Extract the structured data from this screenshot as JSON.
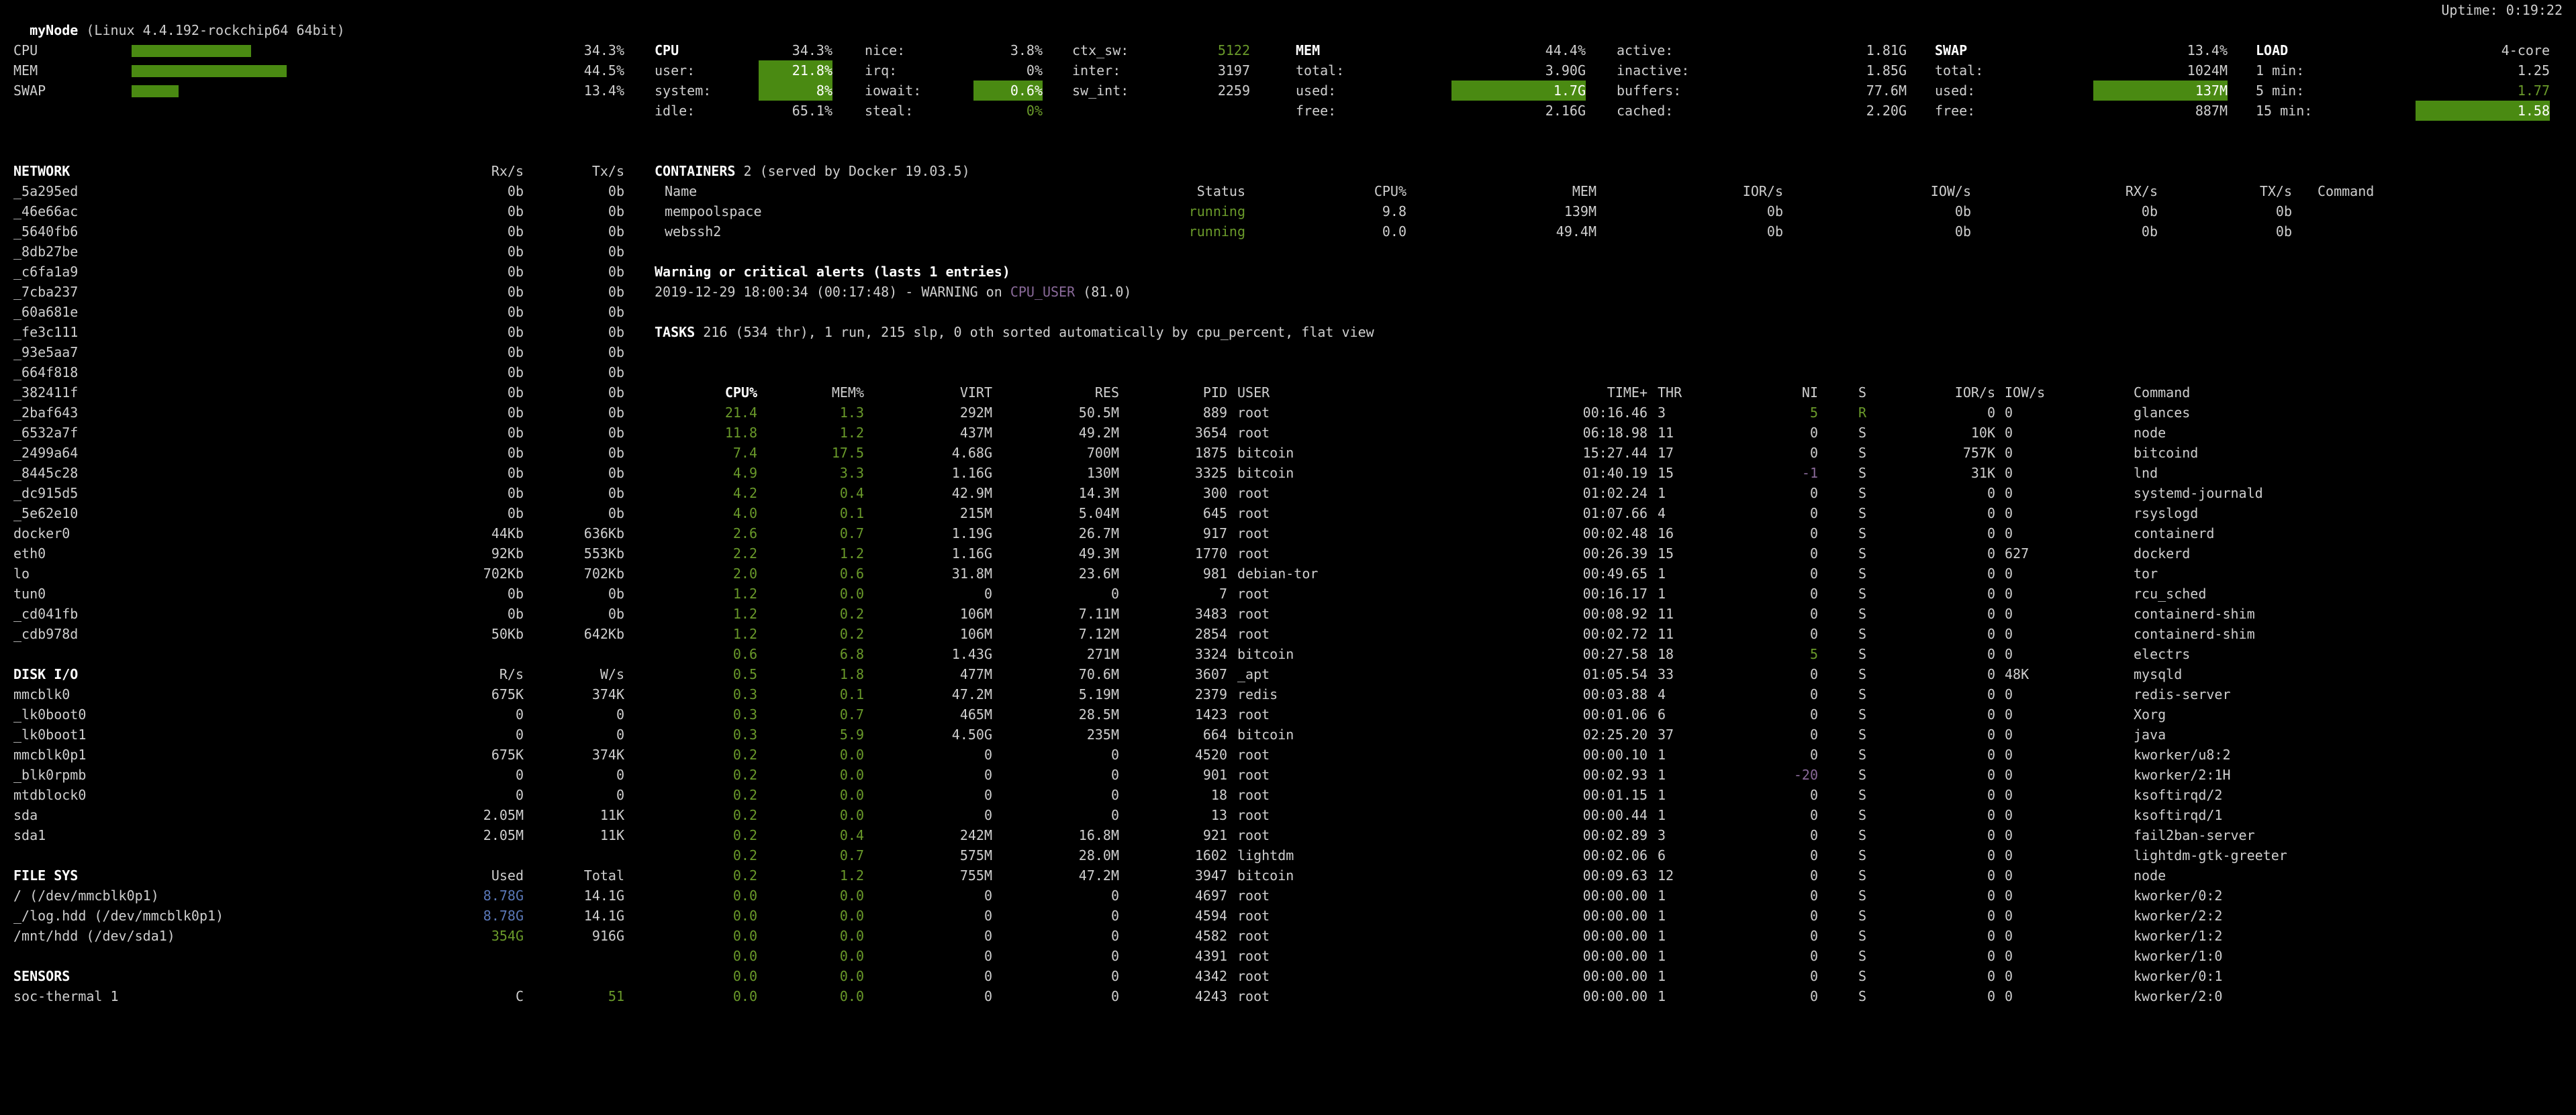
{
  "header": {
    "host": "myNode",
    "os": "(Linux 4.4.192-rockchip64 64bit)",
    "uptime": "Uptime: 0:19:22"
  },
  "quicklook": [
    {
      "label": "CPU",
      "value": "34.3%",
      "fraction": 0.343
    },
    {
      "label": "MEM",
      "value": "44.5%",
      "fraction": 0.445
    },
    {
      "label": "SWAP",
      "value": "13.4%",
      "fraction": 0.134
    }
  ],
  "cpu": {
    "title": "CPU",
    "total": "34.3%",
    "col1": [
      {
        "k": "user:",
        "v": "21.8%",
        "hl": true
      },
      {
        "k": "system:",
        "v": "8%",
        "hl": true
      },
      {
        "k": "idle:",
        "v": "65.1%",
        "hl": false
      }
    ],
    "col2": [
      {
        "k": "nice:",
        "v": "3.8%"
      },
      {
        "k": "irq:",
        "v": "0%"
      },
      {
        "k": "iowait:",
        "v": "0.6%",
        "hl": true
      },
      {
        "k": "steal:",
        "v": "0%",
        "green": true
      }
    ],
    "col3": [
      {
        "k": "ctx_sw:",
        "v": "5122",
        "green": true
      },
      {
        "k": "inter:",
        "v": "3197"
      },
      {
        "k": "sw_int:",
        "v": "2259"
      }
    ]
  },
  "mem": {
    "title": "MEM",
    "total": "44.4%",
    "col1": [
      {
        "k": "total:",
        "v": "3.90G"
      },
      {
        "k": "used:",
        "v": "1.7G",
        "hl": true
      },
      {
        "k": "free:",
        "v": "2.16G"
      }
    ],
    "col2": [
      {
        "k": "active:",
        "v": "1.81G"
      },
      {
        "k": "inactive:",
        "v": "1.85G"
      },
      {
        "k": "buffers:",
        "v": "77.6M"
      },
      {
        "k": "cached:",
        "v": "2.20G"
      }
    ]
  },
  "swap": {
    "title": "SWAP",
    "total": "13.4%",
    "rows": [
      {
        "k": "total:",
        "v": "1024M"
      },
      {
        "k": "used:",
        "v": "137M",
        "hl": true
      },
      {
        "k": "free:",
        "v": "887M"
      }
    ]
  },
  "load": {
    "title": "LOAD",
    "cores": "4-core",
    "rows": [
      {
        "k": "1 min:",
        "v": "1.25"
      },
      {
        "k": "5 min:",
        "v": "1.77",
        "green": true
      },
      {
        "k": "15 min:",
        "v": "1.58",
        "hl": true
      }
    ]
  },
  "network": {
    "title": "NETWORK",
    "rx": "Rx/s",
    "tx": "Tx/s",
    "rows": [
      [
        "_5a295ed",
        "0b",
        "0b"
      ],
      [
        "_46e66ac",
        "0b",
        "0b"
      ],
      [
        "_5640fb6",
        "0b",
        "0b"
      ],
      [
        "_8db27be",
        "0b",
        "0b"
      ],
      [
        "_c6fa1a9",
        "0b",
        "0b"
      ],
      [
        "_7cba237",
        "0b",
        "0b"
      ],
      [
        "_60a681e",
        "0b",
        "0b"
      ],
      [
        "_fe3c111",
        "0b",
        "0b"
      ],
      [
        "_93e5aa7",
        "0b",
        "0b"
      ],
      [
        "_664f818",
        "0b",
        "0b"
      ],
      [
        "_382411f",
        "0b",
        "0b"
      ],
      [
        "_2baf643",
        "0b",
        "0b"
      ],
      [
        "_6532a7f",
        "0b",
        "0b"
      ],
      [
        "_2499a64",
        "0b",
        "0b"
      ],
      [
        "_8445c28",
        "0b",
        "0b"
      ],
      [
        "_dc915d5",
        "0b",
        "0b"
      ],
      [
        "_5e62e10",
        "0b",
        "0b"
      ],
      [
        "docker0",
        "44Kb",
        "636Kb"
      ],
      [
        "eth0",
        "92Kb",
        "553Kb"
      ],
      [
        "lo",
        "702Kb",
        "702Kb"
      ],
      [
        "tun0",
        "0b",
        "0b"
      ],
      [
        "_cd041fb",
        "0b",
        "0b"
      ],
      [
        "_cdb978d",
        "50Kb",
        "642Kb"
      ]
    ]
  },
  "diskio": {
    "title": "DISK I/O",
    "r": "R/s",
    "w": "W/s",
    "rows": [
      [
        "mmcblk0",
        "675K",
        "374K"
      ],
      [
        "_lk0boot0",
        "0",
        "0"
      ],
      [
        "_lk0boot1",
        "0",
        "0"
      ],
      [
        "mmcblk0p1",
        "675K",
        "374K"
      ],
      [
        "_blk0rpmb",
        "0",
        "0"
      ],
      [
        "mtdblock0",
        "0",
        "0"
      ],
      [
        "sda",
        "2.05M",
        "11K"
      ],
      [
        "sda1",
        "2.05M",
        "11K"
      ]
    ]
  },
  "fs": {
    "title": "FILE SYS",
    "used": "Used",
    "total": "Total",
    "rows": [
      {
        "name": "/ (/dev/mmcblk0p1)",
        "used": "8.78G",
        "total": "14.1G",
        "c": "blue"
      },
      {
        "name": "_/log.hdd (/dev/mmcblk0p1)",
        "used": "8.78G",
        "total": "14.1G",
        "c": "blue"
      },
      {
        "name": "/mnt/hdd (/dev/sda1)",
        "used": "354G",
        "total": "916G",
        "c": "green"
      }
    ]
  },
  "sensors": {
    "title": "SENSORS",
    "rows": [
      {
        "name": "soc-thermal 1",
        "unit": "C",
        "value": "51"
      }
    ]
  },
  "containers": {
    "title": "CONTAINERS",
    "count": "2",
    "served": "(served by Docker 19.03.5)",
    "headers": [
      "Name",
      "Status",
      "CPU%",
      "MEM",
      "IOR/s",
      "IOW/s",
      "RX/s",
      "TX/s",
      "Command"
    ],
    "rows": [
      [
        "mempoolspace",
        "running",
        "9.8",
        "139M",
        "0b",
        "0b",
        "0b",
        "0b",
        ""
      ],
      [
        "webssh2",
        "running",
        "0.0",
        "49.4M",
        "0b",
        "0b",
        "0b",
        "0b",
        ""
      ]
    ]
  },
  "alerts": {
    "title": "Warning or critical alerts (lasts 1 entries)",
    "entry_prefix": "2019-12-29 18:00:34 (00:17:48) - WARNING on ",
    "entry_key": "CPU_USER",
    "entry_suffix": " (81.0)"
  },
  "tasks": {
    "title": "TASKS",
    "summary": "216 (534 thr), 1 run, 215 slp, 0 oth sorted automatically by cpu_percent, flat view"
  },
  "processes": {
    "headers": {
      "cpu": "CPU%",
      "mem": "MEM%",
      "virt": "VIRT",
      "res": "RES",
      "pid": "PID",
      "user": "USER",
      "time": "TIME+",
      "thr": "THR",
      "ni": "NI",
      "s": "S",
      "ior": "IOR/s",
      "iow": "IOW/s",
      "cmd": "Command"
    },
    "rows": [
      [
        "21.4",
        "1.3",
        "292M",
        "50.5M",
        "889",
        "root",
        "00:16.46",
        "3",
        "5",
        "R",
        "0",
        "0",
        "glances"
      ],
      [
        "11.8",
        "1.2",
        "437M",
        "49.2M",
        "3654",
        "root",
        "06:18.98",
        "11",
        "0",
        "S",
        "10K",
        "0",
        "node"
      ],
      [
        "7.4",
        "17.5",
        "4.68G",
        "700M",
        "1875",
        "bitcoin",
        "15:27.44",
        "17",
        "0",
        "S",
        "757K",
        "0",
        "bitcoind"
      ],
      [
        "4.9",
        "3.3",
        "1.16G",
        "130M",
        "3325",
        "bitcoin",
        "01:40.19",
        "15",
        "-1",
        "S",
        "31K",
        "0",
        "lnd"
      ],
      [
        "4.2",
        "0.4",
        "42.9M",
        "14.3M",
        "300",
        "root",
        "01:02.24",
        "1",
        "0",
        "S",
        "0",
        "0",
        "systemd-journald"
      ],
      [
        "4.0",
        "0.1",
        "215M",
        "5.04M",
        "645",
        "root",
        "01:07.66",
        "4",
        "0",
        "S",
        "0",
        "0",
        "rsyslogd"
      ],
      [
        "2.6",
        "0.7",
        "1.19G",
        "26.7M",
        "917",
        "root",
        "00:02.48",
        "16",
        "0",
        "S",
        "0",
        "0",
        "containerd"
      ],
      [
        "2.2",
        "1.2",
        "1.16G",
        "49.3M",
        "1770",
        "root",
        "00:26.39",
        "15",
        "0",
        "S",
        "0",
        "627",
        "dockerd"
      ],
      [
        "2.0",
        "0.6",
        "31.8M",
        "23.6M",
        "981",
        "debian-tor",
        "00:49.65",
        "1",
        "0",
        "S",
        "0",
        "0",
        "tor"
      ],
      [
        "1.2",
        "0.0",
        "0",
        "0",
        "7",
        "root",
        "00:16.17",
        "1",
        "0",
        "S",
        "0",
        "0",
        "rcu_sched"
      ],
      [
        "1.2",
        "0.2",
        "106M",
        "7.11M",
        "3483",
        "root",
        "00:08.92",
        "11",
        "0",
        "S",
        "0",
        "0",
        "containerd-shim"
      ],
      [
        "1.2",
        "0.2",
        "106M",
        "7.12M",
        "2854",
        "root",
        "00:02.72",
        "11",
        "0",
        "S",
        "0",
        "0",
        "containerd-shim"
      ],
      [
        "0.6",
        "6.8",
        "1.43G",
        "271M",
        "3324",
        "bitcoin",
        "00:27.58",
        "18",
        "5",
        "S",
        "0",
        "0",
        "electrs"
      ],
      [
        "0.5",
        "1.8",
        "477M",
        "70.6M",
        "3607",
        "_apt",
        "01:05.54",
        "33",
        "0",
        "S",
        "0",
        "48K",
        "mysqld"
      ],
      [
        "0.3",
        "0.1",
        "47.2M",
        "5.19M",
        "2379",
        "redis",
        "00:03.88",
        "4",
        "0",
        "S",
        "0",
        "0",
        "redis-server"
      ],
      [
        "0.3",
        "0.7",
        "465M",
        "28.5M",
        "1423",
        "root",
        "00:01.06",
        "6",
        "0",
        "S",
        "0",
        "0",
        "Xorg"
      ],
      [
        "0.3",
        "5.9",
        "4.50G",
        "235M",
        "664",
        "bitcoin",
        "02:25.20",
        "37",
        "0",
        "S",
        "0",
        "0",
        "java"
      ],
      [
        "0.2",
        "0.0",
        "0",
        "0",
        "4520",
        "root",
        "00:00.10",
        "1",
        "0",
        "S",
        "0",
        "0",
        "kworker/u8:2"
      ],
      [
        "0.2",
        "0.0",
        "0",
        "0",
        "901",
        "root",
        "00:02.93",
        "1",
        "-20",
        "S",
        "0",
        "0",
        "kworker/2:1H"
      ],
      [
        "0.2",
        "0.0",
        "0",
        "0",
        "18",
        "root",
        "00:01.15",
        "1",
        "0",
        "S",
        "0",
        "0",
        "ksoftirqd/2"
      ],
      [
        "0.2",
        "0.0",
        "0",
        "0",
        "13",
        "root",
        "00:00.44",
        "1",
        "0",
        "S",
        "0",
        "0",
        "ksoftirqd/1"
      ],
      [
        "0.2",
        "0.4",
        "242M",
        "16.8M",
        "921",
        "root",
        "00:02.89",
        "3",
        "0",
        "S",
        "0",
        "0",
        "fail2ban-server"
      ],
      [
        "0.2",
        "0.7",
        "575M",
        "28.0M",
        "1602",
        "lightdm",
        "00:02.06",
        "6",
        "0",
        "S",
        "0",
        "0",
        "lightdm-gtk-greeter"
      ],
      [
        "0.2",
        "1.2",
        "755M",
        "47.2M",
        "3947",
        "bitcoin",
        "00:09.63",
        "12",
        "0",
        "S",
        "0",
        "0",
        "node"
      ],
      [
        "0.0",
        "0.0",
        "0",
        "0",
        "4697",
        "root",
        "00:00.00",
        "1",
        "0",
        "S",
        "0",
        "0",
        "kworker/0:2"
      ],
      [
        "0.0",
        "0.0",
        "0",
        "0",
        "4594",
        "root",
        "00:00.00",
        "1",
        "0",
        "S",
        "0",
        "0",
        "kworker/2:2"
      ],
      [
        "0.0",
        "0.0",
        "0",
        "0",
        "4582",
        "root",
        "00:00.00",
        "1",
        "0",
        "S",
        "0",
        "0",
        "kworker/1:2"
      ],
      [
        "0.0",
        "0.0",
        "0",
        "0",
        "4391",
        "root",
        "00:00.00",
        "1",
        "0",
        "S",
        "0",
        "0",
        "kworker/1:0"
      ],
      [
        "0.0",
        "0.0",
        "0",
        "0",
        "4342",
        "root",
        "00:00.00",
        "1",
        "0",
        "S",
        "0",
        "0",
        "kworker/0:1"
      ],
      [
        "0.0",
        "0.0",
        "0",
        "0",
        "4243",
        "root",
        "00:00.00",
        "1",
        "0",
        "S",
        "0",
        "0",
        "kworker/2:0"
      ]
    ]
  },
  "colors": {
    "accent_bar": "#4a8a12",
    "ok": "#6a9a2a",
    "careful": "#8a6a9a",
    "fs_blue": "#5a78b8"
  }
}
